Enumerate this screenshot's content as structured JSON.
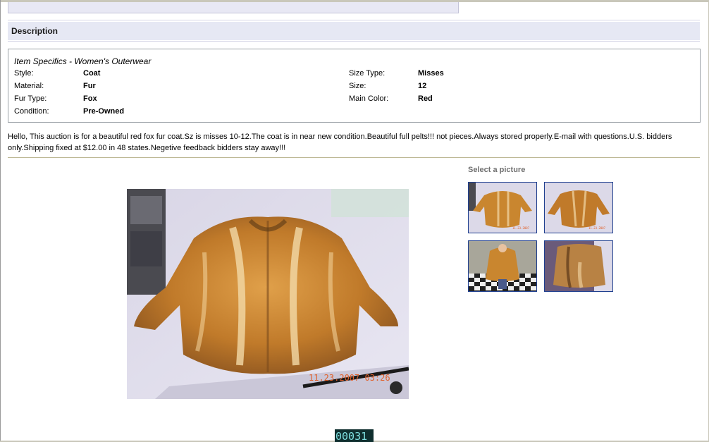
{
  "description": {
    "title": "Description"
  },
  "item_specifics": {
    "heading": "Item Specifics - Women's Outerwear",
    "left": [
      {
        "label": "Style:",
        "value": "Coat"
      },
      {
        "label": "Material:",
        "value": "Fur"
      },
      {
        "label": "Fur Type:",
        "value": "Fox"
      },
      {
        "label": "Condition:",
        "value": "Pre-Owned"
      }
    ],
    "right": [
      {
        "label": "Size Type:",
        "value": "Misses"
      },
      {
        "label": "Size:",
        "value": "12"
      },
      {
        "label": "Main Color:",
        "value": "Red"
      }
    ]
  },
  "seller_text": "Hello,  This auction is for a beautiful red fox fur coat.Sz is misses 10-12.The coat is in near new condition.Beautiful full pelts!!! not pieces.Always stored properly.E-mail with questions.U.S. bidders only.Shipping fixed at $12.00 in 48 states.Negetive feedback bidders stay away!!!",
  "gallery": {
    "select_label": "Select a picture",
    "main_photo_timestamp": "11.23.2007 03:26",
    "thumb_timestamp": "11.23.2007"
  },
  "counter": "00031",
  "colors": {
    "header_bg": "#e6e8f4",
    "thumb_border": "#1f3f8f",
    "fur": "#c9862f",
    "timestamp": "#e0602a"
  }
}
